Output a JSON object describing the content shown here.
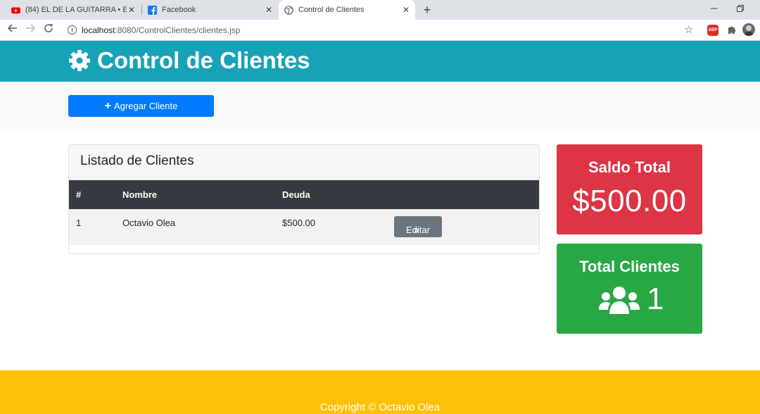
{
  "browser": {
    "tabs": [
      {
        "label": "(84) EL DE LA GUITARRA • EL SO",
        "icon": "youtube-icon"
      },
      {
        "label": "Facebook",
        "icon": "facebook-icon"
      },
      {
        "label": "Control de Clientes",
        "icon": "globe-icon"
      }
    ],
    "close_glyph": "✕",
    "new_tab_glyph": "+",
    "url_host": "localhost",
    "url_path": ":8080/ControlClientes/clientes.jsp",
    "abp_label": "ABP"
  },
  "header": {
    "title": "Control de Clientes",
    "icon": "gear-icon",
    "color": "#17a2b8"
  },
  "actions": {
    "add_label": "Agregar Cliente",
    "add_color": "#007bff"
  },
  "clients_card": {
    "title": "Listado de Clientes",
    "columns": [
      "#",
      "Nombre",
      "Deuda"
    ],
    "rows": [
      {
        "num": "1",
        "nombre": "Octavio Olea",
        "deuda": "$500.00",
        "action_label": "Editar"
      }
    ]
  },
  "saldo": {
    "label": "Saldo Total",
    "value": "$500.00",
    "color": "#dc3545"
  },
  "total_clientes": {
    "label": "Total Clientes",
    "value": "1",
    "icon": "users-icon",
    "color": "#28a745"
  },
  "footer": {
    "text": "Copyright © Octavio Olea",
    "color": "#ffc107"
  }
}
